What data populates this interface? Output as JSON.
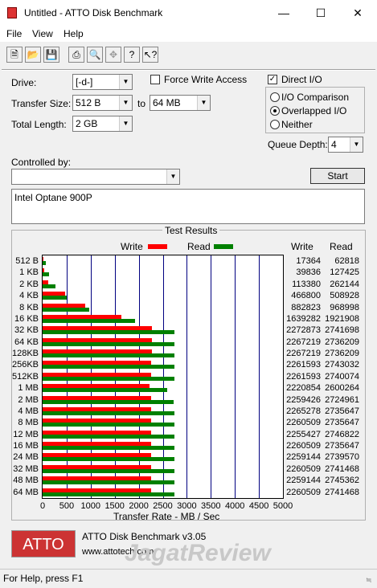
{
  "window": {
    "title": "Untitled - ATTO Disk Benchmark"
  },
  "menu": [
    "File",
    "View",
    "Help"
  ],
  "toolbar_icons": [
    "new-file-icon",
    "open-folder-icon",
    "save-icon",
    "print-icon",
    "print-preview-icon",
    "move-icon",
    "help-icon",
    "context-help-icon"
  ],
  "form": {
    "drive_label": "Drive:",
    "drive_value": "[-d-]",
    "transfer_size_label": "Transfer Size:",
    "transfer_from": "512 B",
    "to_label": "to",
    "transfer_to": "64 MB",
    "total_length_label": "Total Length:",
    "total_length_value": "2 GB",
    "force_write_access_label": "Force Write Access",
    "direct_io_label": "Direct I/O",
    "io_comparison_label": "I/O Comparison",
    "overlapped_io_label": "Overlapped I/O",
    "neither_label": "Neither",
    "queue_depth_label": "Queue Depth:",
    "queue_depth_value": "4",
    "controlled_by_label": "Controlled by:",
    "controlled_by_value": "",
    "start_label": "Start",
    "description": "Intel Optane 900P"
  },
  "results": {
    "title": "Test Results",
    "write_legend": "Write",
    "read_legend": "Read",
    "write_header": "Write",
    "read_header": "Read",
    "xlabel": "Transfer Rate - MB / Sec"
  },
  "colors": {
    "write": "#ff0000",
    "read": "#008000",
    "grid": "#000080"
  },
  "chart_data": {
    "type": "bar",
    "orientation": "horizontal",
    "categories": [
      "512 B",
      "1 KB",
      "2 KB",
      "4 KB",
      "8 KB",
      "16 KB",
      "32 KB",
      "64 KB",
      "128KB",
      "256KB",
      "512KB",
      "1 MB",
      "2 MB",
      "4 MB",
      "8 MB",
      "12 MB",
      "16 MB",
      "24 MB",
      "32 MB",
      "48 MB",
      "64 MB"
    ],
    "series": [
      {
        "name": "Write",
        "values": [
          17364,
          39836,
          113380,
          466800,
          882823,
          1639282,
          2272873,
          2267219,
          2267219,
          2261593,
          2261593,
          2220854,
          2259426,
          2265278,
          2260509,
          2255427,
          2260509,
          2259144,
          2260509,
          2259144,
          2260509
        ]
      },
      {
        "name": "Read",
        "values": [
          62818,
          127425,
          262144,
          508928,
          968998,
          1921908,
          2741698,
          2736209,
          2736209,
          2743032,
          2740074,
          2600264,
          2724961,
          2735647,
          2735647,
          2746822,
          2735647,
          2739570,
          2741468,
          2745362,
          2741468
        ]
      }
    ],
    "bar_scale_divisor": 1000,
    "xticks": [
      "0",
      "500",
      "1000",
      "1500",
      "2000",
      "2500",
      "3000",
      "3500",
      "4000",
      "4500",
      "5000"
    ],
    "xlim": [
      0,
      5000
    ],
    "xlabel": "Transfer Rate - MB / Sec"
  },
  "footer": {
    "logo_text": "ATTO",
    "app_version": "ATTO Disk Benchmark v3.05",
    "url": "www.attotech.com",
    "watermark": "JagatReview"
  },
  "status": {
    "text": "For Help, press F1"
  }
}
